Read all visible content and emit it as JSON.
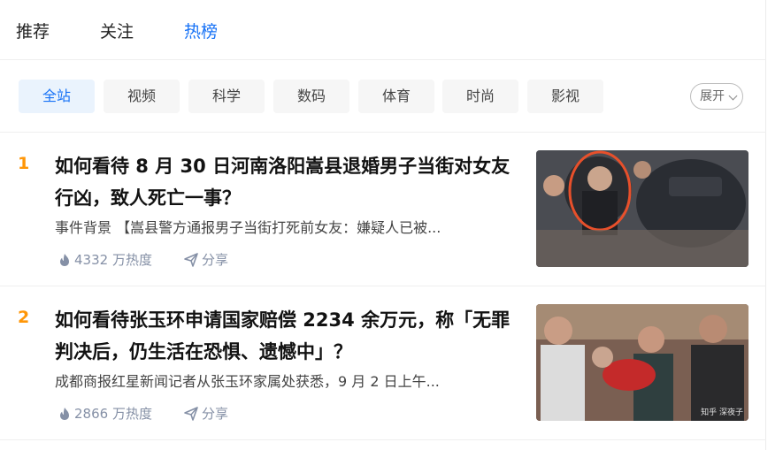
{
  "topnav": {
    "tabs": [
      {
        "label": "推荐"
      },
      {
        "label": "关注"
      },
      {
        "label": "热榜"
      }
    ],
    "active": "热榜",
    "accent_color": "#1772f6"
  },
  "categories": {
    "items": [
      {
        "label": "全站"
      },
      {
        "label": "视频"
      },
      {
        "label": "科学"
      },
      {
        "label": "数码"
      },
      {
        "label": "体育"
      },
      {
        "label": "时尚"
      },
      {
        "label": "影视"
      }
    ],
    "active": "全站",
    "expand_label": "展开"
  },
  "items": [
    {
      "rank": "1",
      "title": "如何看待 8 月 30 日河南洛阳嵩县退婚男子当街对女友行凶，致人死亡一事？",
      "excerpt": "事件背景 【嵩县警方通报男子当街打死前女友：嫌疑人已被...",
      "heat": "4332 万热度",
      "share": "分享",
      "thumbnail": {
        "icon": "news-photo"
      }
    },
    {
      "rank": "2",
      "title": "如何看待张玉环申请国家赔偿 2234 余万元，称「无罪判决后，仍生活在恐惧、遗憾中」？",
      "excerpt": "成都商报红星新闻记者从张玉环家属处获悉，9 月 2 日上午...",
      "heat": "2866 万热度",
      "share": "分享",
      "thumbnail": {
        "icon": "news-photo",
        "watermark": "知乎 深夜子"
      }
    }
  ],
  "colors": {
    "rank": "#ff9607",
    "meta": "#8590a6",
    "chip_bg": "#f6f6f6",
    "chip_active_bg": "#eaf3fd"
  }
}
